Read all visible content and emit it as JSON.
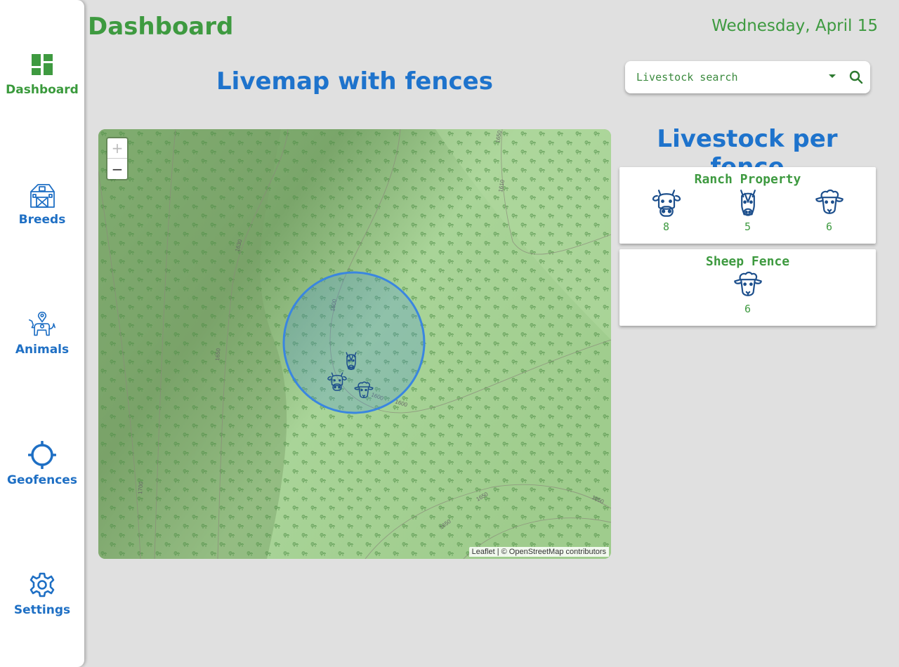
{
  "sidebar": {
    "items": [
      {
        "label": "Dashboard",
        "icon": "dashboard-icon",
        "active": true
      },
      {
        "label": "Breeds",
        "icon": "barn-icon"
      },
      {
        "label": "Animals",
        "icon": "animals-icon"
      },
      {
        "label": "Geofences",
        "icon": "crosshair-icon"
      },
      {
        "label": "Settings",
        "icon": "gear-icon"
      }
    ]
  },
  "header": {
    "title": "Dashboard",
    "date": "Wednesday, April 15"
  },
  "map_section": {
    "heading": "Livemap with fences",
    "zoom_in": "+",
    "zoom_out": "−",
    "attribution_leaflet": "Leaflet",
    "attribution_rest": " | © OpenStreetMap contributors",
    "contour_labels": [
      "1650",
      "1610",
      "1630",
      "1600",
      "1650",
      "1600",
      "1600",
      "1700",
      "1650",
      "1650",
      "1650"
    ],
    "markers": [
      "horse-icon",
      "cow-icon",
      "sheep-icon"
    ]
  },
  "search": {
    "placeholder": "Livestock search"
  },
  "fences": {
    "heading": "Livestock per fence",
    "cards": [
      {
        "name": "Ranch Property",
        "animals": [
          {
            "icon": "cow-icon",
            "count": "8"
          },
          {
            "icon": "horse-icon",
            "count": "5"
          },
          {
            "icon": "sheep-icon",
            "count": "6"
          }
        ]
      },
      {
        "name": "Sheep Fence",
        "animals": [
          {
            "icon": "sheep-icon",
            "count": "6"
          }
        ]
      }
    ]
  },
  "colors": {
    "green": "#3e9a40",
    "blue": "#1e73cc",
    "icon_blue": "#1d4f8c"
  }
}
